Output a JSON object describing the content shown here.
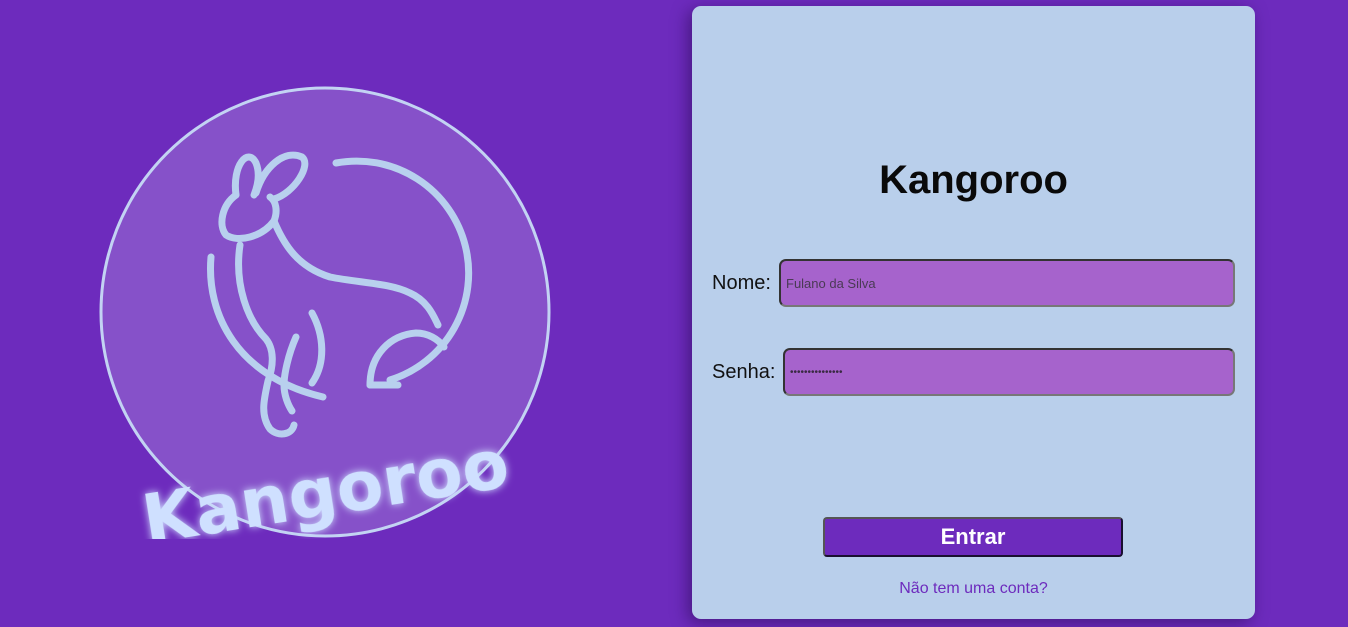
{
  "logo": {
    "text": "Kangoroo",
    "icon": "kangaroo-icon"
  },
  "login": {
    "title": "Kangoroo",
    "name_label": "Nome:",
    "name_placeholder": "Fulano da Silva",
    "password_label": "Senha:",
    "password_value": "•••••••••••••••",
    "submit_label": "Entrar",
    "signup_link": "Não tem uma conta?"
  },
  "colors": {
    "background": "#6d2bbd",
    "card": "#b9cfeb",
    "input": "#a663cc",
    "logo_circle": "#8651c9",
    "logo_line": "#b8d0ee"
  }
}
